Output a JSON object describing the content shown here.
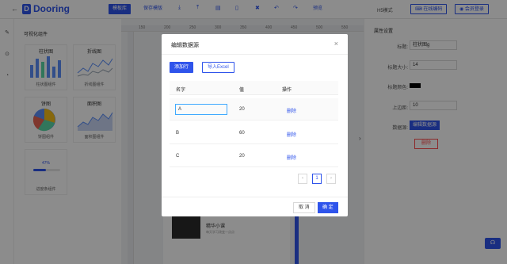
{
  "header": {
    "logo_mark": "D",
    "logo_text": "Dooring",
    "buttons": [
      "模板库",
      "保存模版",
      "预览"
    ],
    "mode_label": "H5模式",
    "online_code": "在线编码",
    "login": "会员登录"
  },
  "components": {
    "title": "可视化组件",
    "cards": [
      {
        "top": "柱状图",
        "bottom": "柱状图组件"
      },
      {
        "top": "折线图",
        "bottom": "折线图组件"
      },
      {
        "top": "饼图",
        "bottom": "饼图组件"
      },
      {
        "top": "面积图",
        "bottom": "面积图组件"
      },
      {
        "top": "",
        "bottom": "进度条组件",
        "progress_label": "47%"
      }
    ]
  },
  "canvas": {
    "ruler_numbers": [
      "150",
      "200",
      "250",
      "300",
      "350",
      "400",
      "450",
      "500",
      "550"
    ],
    "card_title": "精华小课",
    "card_subtitle": "每天学习改变一点点"
  },
  "properties": {
    "title": "属性设置",
    "title_label": "标题:",
    "title_value": "柱状图g",
    "font_size_label": "标题大小:",
    "font_size_value": "14",
    "color_label": "标题颜色:",
    "color_value": "#000000",
    "margin_label": "上边距:",
    "margin_value": "10",
    "data_label": "数据源:",
    "edit_data": "编辑数据源",
    "delete": "删除"
  },
  "modal": {
    "title": "编辑数据源",
    "add_row": "添加行",
    "import_excel": "导入Excel",
    "columns": [
      "名字",
      "值",
      "操作"
    ],
    "rows": [
      {
        "name": "A",
        "value": "20",
        "action": "删除"
      },
      {
        "name": "B",
        "value": "60",
        "action": "删除"
      },
      {
        "name": "C",
        "value": "20",
        "action": "删除"
      }
    ],
    "pager": {
      "prev": "‹",
      "page": "1",
      "next": "›"
    },
    "cancel": "取 消",
    "ok": "确 定"
  },
  "colors": {
    "primary": "#2f54eb",
    "danger": "#ff4d4f"
  },
  "icons": [
    "back-arrow-icon",
    "download-icon",
    "file-icon",
    "mobile-icon",
    "trash-icon",
    "undo-icon",
    "redo-icon",
    "code-icon",
    "user-icon",
    "plus-icon",
    "help-icon"
  ]
}
